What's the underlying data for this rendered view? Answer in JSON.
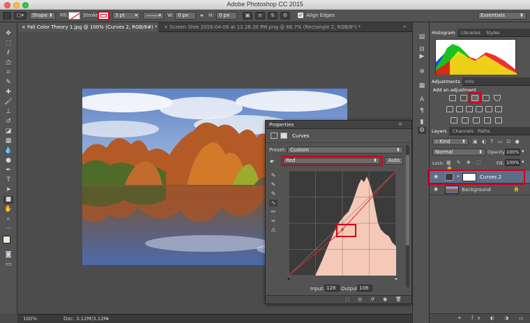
{
  "app": {
    "title": "Adobe Photoshop CC 2015"
  },
  "options": {
    "shape_mode": "Shape",
    "fill_label": "Fill:",
    "stroke_label": "Stroke:",
    "stroke_width": "3 pt",
    "w_label": "W:",
    "w_value": "0 px",
    "h_label": "H:",
    "h_value": "0 px",
    "align_edges_label": "Align Edges",
    "align_edges_checked": true,
    "workspace": "Essentials"
  },
  "doc_tabs": [
    {
      "label": "Fall Color Theory 1.jpg @ 100% (Curves 2, RGB/8#) *",
      "active": true
    },
    {
      "label": "Screen Shot 2016-04-08 at 12.26.30 PM.png @ 66.7% (Rectangle 2, RGB/8*) *",
      "active": false
    }
  ],
  "status": {
    "zoom": "100%",
    "doc": "Doc: 3.12M/3.12M"
  },
  "histogram_panel": {
    "tabs": [
      "Histogram",
      "Libraries",
      "Styles"
    ]
  },
  "adjustments_panel": {
    "tabs": [
      "Adjustments",
      "Info"
    ],
    "heading": "Add an adjustment"
  },
  "layers_panel": {
    "tabs": [
      "Layers",
      "Channels",
      "Paths"
    ],
    "kind_filter": "Kind",
    "blend_mode": "Normal",
    "opacity_label": "Opacity:",
    "opacity_value": "100%",
    "lock_label": "Lock:",
    "fill_label": "Fill:",
    "fill_value": "100%",
    "layers": [
      {
        "name": "Curves 2",
        "selected": true
      },
      {
        "name": "Background",
        "selected": false
      }
    ]
  },
  "properties": {
    "title": "Properties",
    "subtitle": "Curves",
    "preset_label": "Preset:",
    "preset_value": "Custom",
    "channel": "Red",
    "auto_label": "Auto",
    "input_label": "Input:",
    "input_value": "128",
    "output_label": "Output:",
    "output_value": "108"
  },
  "colors": {
    "highlight": "#d0021b",
    "panel": "#535353",
    "canvas": "#4c4c4c",
    "curve_fill": "#f4c9b8"
  },
  "icons": [
    "close-icon",
    "minimize-icon",
    "zoom-icon",
    "shape-tool-icon",
    "eye-icon",
    "lock-icon",
    "curves-adjustment-icon",
    "trash-icon",
    "reset-icon"
  ]
}
